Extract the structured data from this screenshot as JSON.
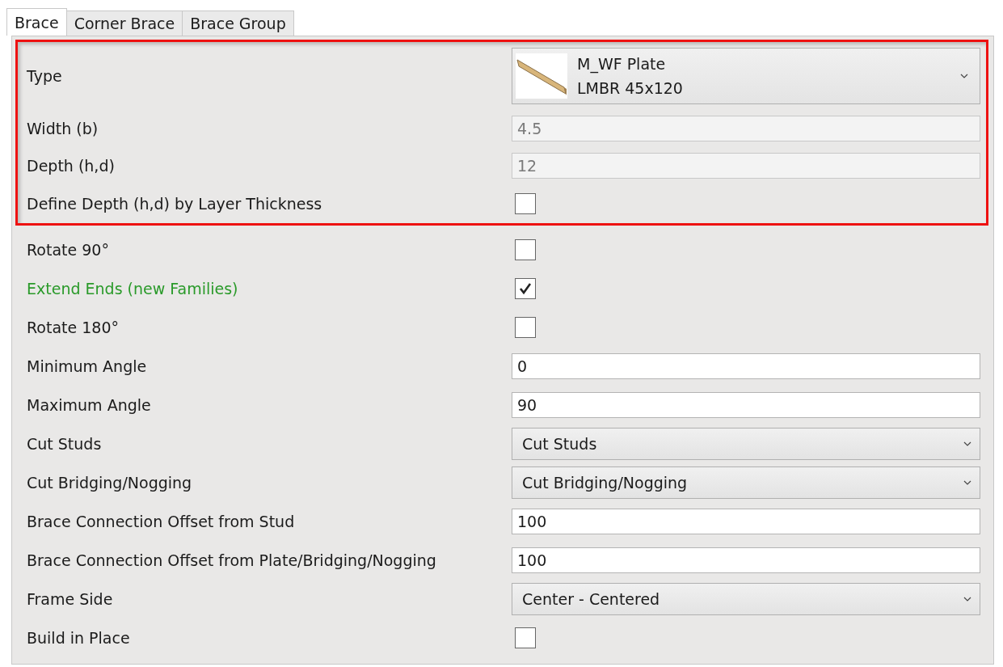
{
  "tabs": [
    {
      "label": "Brace",
      "selected": true
    },
    {
      "label": "Corner Brace",
      "selected": false
    },
    {
      "label": "Brace Group",
      "selected": false
    }
  ],
  "highlighted_group": [
    {
      "kind": "type",
      "label": "Type",
      "value_line_1": "M_WF Plate",
      "value_line_2": "LMBR 45x120"
    },
    {
      "kind": "text",
      "label": "Width (b)",
      "value": "4.5",
      "disabled": true
    },
    {
      "kind": "text",
      "label": "Depth (h,d)",
      "value": "12",
      "disabled": true
    },
    {
      "kind": "checkbox",
      "label": "Define Depth (h,d) by Layer Thickness",
      "checked": false
    }
  ],
  "properties": [
    {
      "kind": "checkbox",
      "label": "Rotate 90°",
      "checked": false
    },
    {
      "kind": "checkbox",
      "label": "Extend Ends (new Families)",
      "checked": true,
      "color": "#2a9a2a"
    },
    {
      "kind": "checkbox",
      "label": "Rotate 180°",
      "checked": false
    },
    {
      "kind": "text",
      "label": "Minimum Angle",
      "value": "0",
      "disabled": false
    },
    {
      "kind": "text",
      "label": "Maximum Angle",
      "value": "90",
      "disabled": false
    },
    {
      "kind": "dropdown",
      "label": "Cut Studs",
      "value": "Cut Studs"
    },
    {
      "kind": "dropdown",
      "label": "Cut Bridging/Nogging",
      "value": "Cut Bridging/Nogging"
    },
    {
      "kind": "text",
      "label": "Brace Connection Offset from Stud",
      "value": "100",
      "disabled": false
    },
    {
      "kind": "text",
      "label": "Brace Connection Offset from Plate/Bridging/Nogging",
      "value": "100",
      "disabled": false
    },
    {
      "kind": "dropdown",
      "label": "Frame Side",
      "value": "Center - Centered"
    },
    {
      "kind": "checkbox",
      "label": "Build in Place",
      "checked": false
    }
  ]
}
